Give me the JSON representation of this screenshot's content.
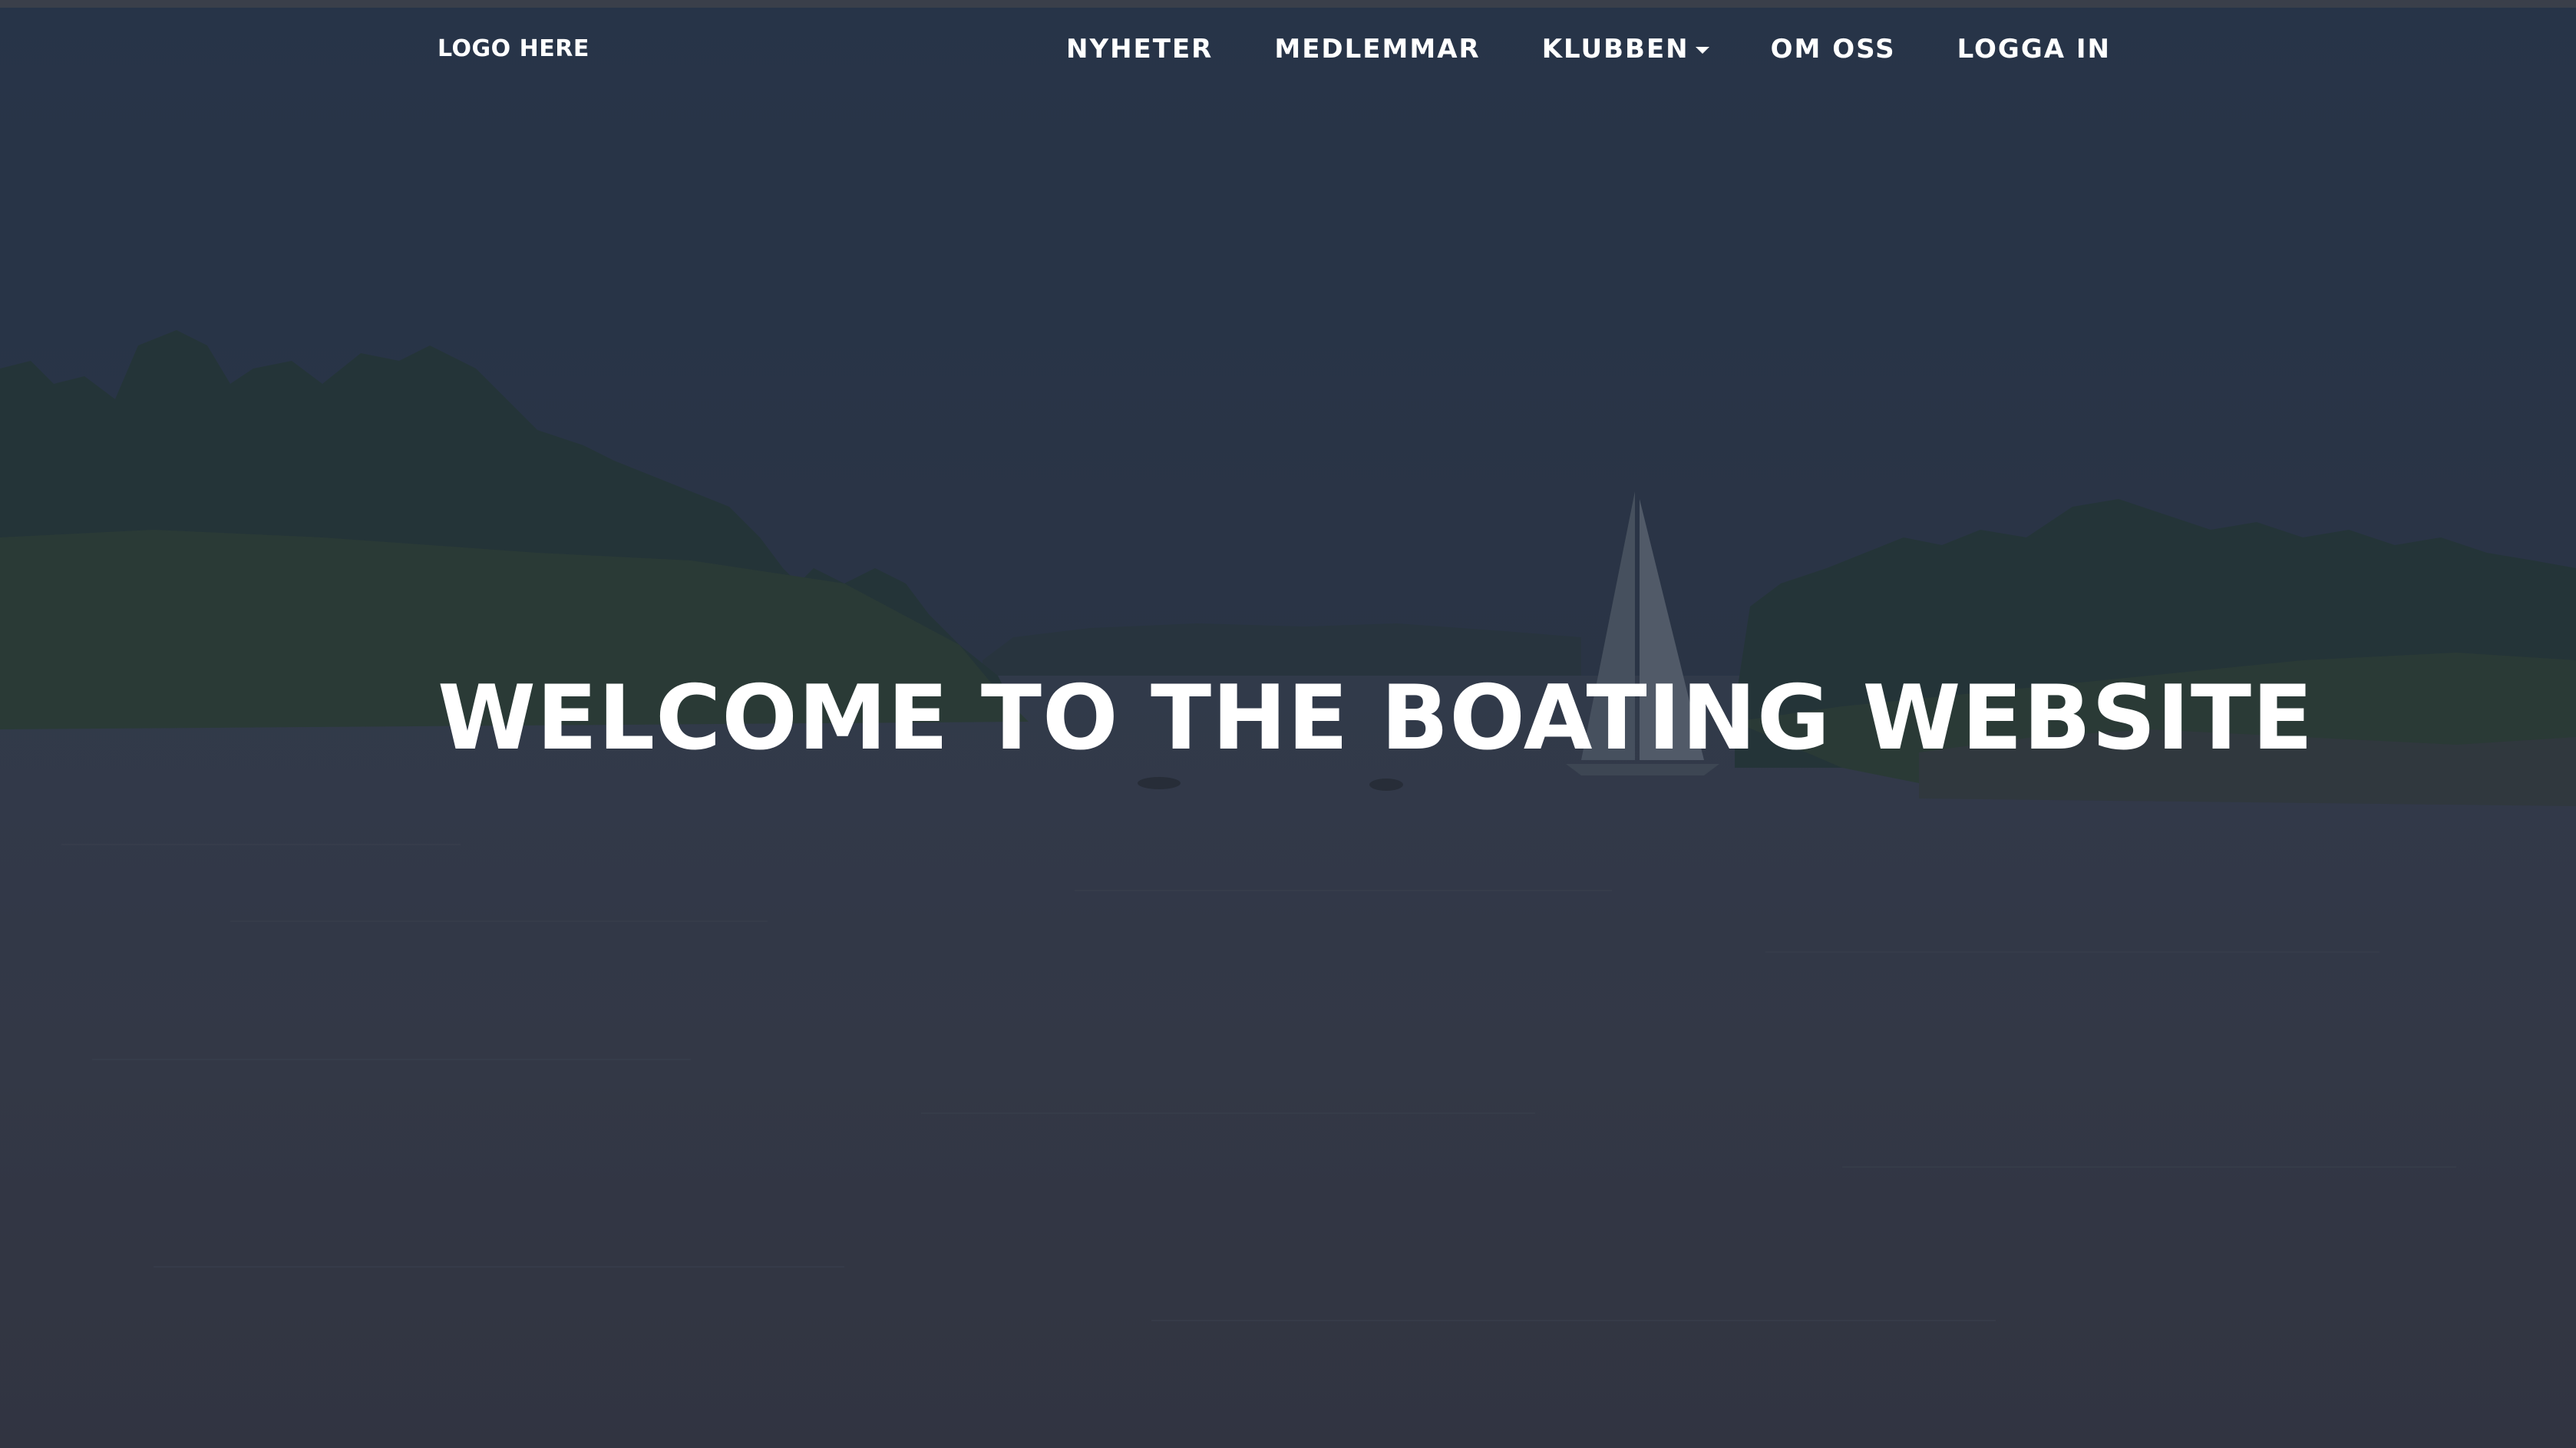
{
  "brand": {
    "logo_text": "LOGO HERE"
  },
  "nav": {
    "items": [
      {
        "label": "NYHETER",
        "icon": null
      },
      {
        "label": "MEDLEMMAR",
        "icon": null
      },
      {
        "label": "KLUBBEN",
        "icon": "chevron-down-icon"
      },
      {
        "label": "OM OSS",
        "icon": null
      },
      {
        "label": "LOGGA IN",
        "icon": null
      }
    ]
  },
  "hero": {
    "title": "WELCOME TO THE BOATING WEBSITE",
    "background": "sailboat-in-archipelago-photo"
  },
  "colors": {
    "sky": "#2b3a4e",
    "water": "#3b3f4b",
    "text": "#ffffff"
  }
}
